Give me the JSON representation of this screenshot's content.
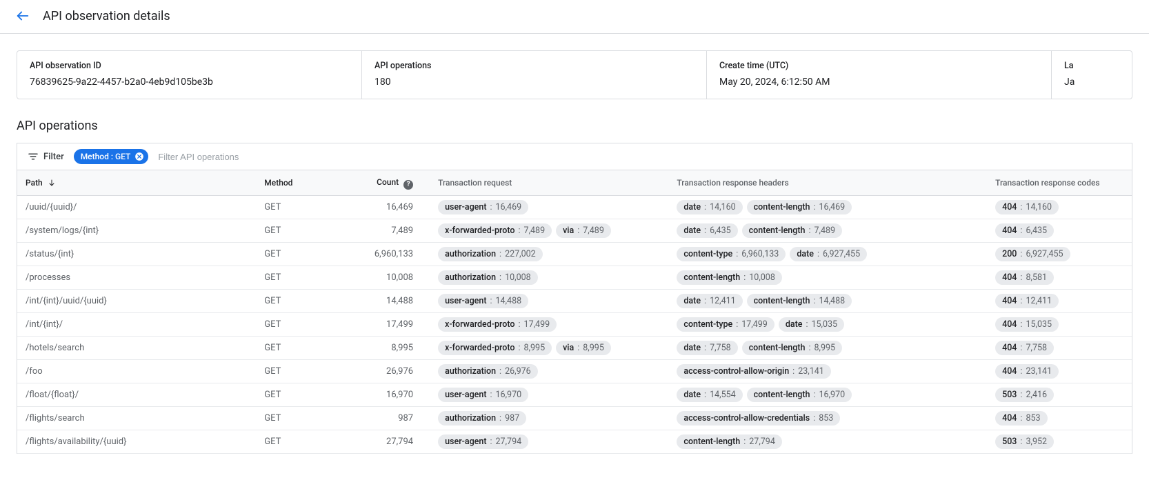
{
  "page": {
    "title": "API observation details"
  },
  "summary": {
    "id": {
      "label": "API observation ID",
      "value": "76839625-9a22-4457-b2a0-4eb9d105be3b"
    },
    "ops": {
      "label": "API operations",
      "value": "180"
    },
    "create": {
      "label": "Create time (UTC)",
      "value": "May 20, 2024, 6:12:50 AM"
    },
    "last": {
      "label": "La",
      "value": "Ja"
    }
  },
  "section": {
    "ops_title": "API operations"
  },
  "filter": {
    "label": "Filter",
    "chip": {
      "text": "Method : GET"
    },
    "placeholder": "Filter API operations"
  },
  "headers": {
    "path": "Path",
    "method": "Method",
    "count": "Count",
    "req": "Transaction request",
    "resp_h": "Transaction response headers",
    "resp_c": "Transaction response codes"
  },
  "rows": [
    {
      "path": "/uuid/{uuid}/",
      "method": "GET",
      "count": "16,469",
      "req": [
        {
          "k": "user-agent",
          "v": "16,469"
        }
      ],
      "resp_h": [
        {
          "k": "date",
          "v": "14,160"
        },
        {
          "k": "content-length",
          "v": "16,469"
        }
      ],
      "resp_c": [
        {
          "k": "404",
          "v": "14,160"
        }
      ]
    },
    {
      "path": "/system/logs/{int}",
      "method": "GET",
      "count": "7,489",
      "req": [
        {
          "k": "x-forwarded-proto",
          "v": "7,489"
        },
        {
          "k": "via",
          "v": "7,489"
        }
      ],
      "resp_h": [
        {
          "k": "date",
          "v": "6,435"
        },
        {
          "k": "content-length",
          "v": "7,489"
        }
      ],
      "resp_c": [
        {
          "k": "404",
          "v": "6,435"
        }
      ]
    },
    {
      "path": "/status/{int}",
      "method": "GET",
      "count": "6,960,133",
      "req": [
        {
          "k": "authorization",
          "v": "227,002"
        }
      ],
      "resp_h": [
        {
          "k": "content-type",
          "v": "6,960,133"
        },
        {
          "k": "date",
          "v": "6,927,455"
        }
      ],
      "resp_c": [
        {
          "k": "200",
          "v": "6,927,455"
        }
      ]
    },
    {
      "path": "/processes",
      "method": "GET",
      "count": "10,008",
      "req": [
        {
          "k": "authorization",
          "v": "10,008"
        }
      ],
      "resp_h": [
        {
          "k": "content-length",
          "v": "10,008"
        }
      ],
      "resp_c": [
        {
          "k": "404",
          "v": "8,581"
        }
      ]
    },
    {
      "path": "/int/{int}/uuid/{uuid}",
      "method": "GET",
      "count": "14,488",
      "req": [
        {
          "k": "user-agent",
          "v": "14,488"
        }
      ],
      "resp_h": [
        {
          "k": "date",
          "v": "12,411"
        },
        {
          "k": "content-length",
          "v": "14,488"
        }
      ],
      "resp_c": [
        {
          "k": "404",
          "v": "12,411"
        }
      ]
    },
    {
      "path": "/int/{int}/",
      "method": "GET",
      "count": "17,499",
      "req": [
        {
          "k": "x-forwarded-proto",
          "v": "17,499"
        }
      ],
      "resp_h": [
        {
          "k": "content-type",
          "v": "17,499"
        },
        {
          "k": "date",
          "v": "15,035"
        }
      ],
      "resp_c": [
        {
          "k": "404",
          "v": "15,035"
        }
      ]
    },
    {
      "path": "/hotels/search",
      "method": "GET",
      "count": "8,995",
      "req": [
        {
          "k": "x-forwarded-proto",
          "v": "8,995"
        },
        {
          "k": "via",
          "v": "8,995"
        }
      ],
      "resp_h": [
        {
          "k": "date",
          "v": "7,758"
        },
        {
          "k": "content-length",
          "v": "8,995"
        }
      ],
      "resp_c": [
        {
          "k": "404",
          "v": "7,758"
        }
      ]
    },
    {
      "path": "/foo",
      "method": "GET",
      "count": "26,976",
      "req": [
        {
          "k": "authorization",
          "v": "26,976"
        }
      ],
      "resp_h": [
        {
          "k": "access-control-allow-origin",
          "v": "23,141"
        }
      ],
      "resp_c": [
        {
          "k": "404",
          "v": "23,141"
        }
      ]
    },
    {
      "path": "/float/{float}/",
      "method": "GET",
      "count": "16,970",
      "req": [
        {
          "k": "user-agent",
          "v": "16,970"
        }
      ],
      "resp_h": [
        {
          "k": "date",
          "v": "14,554"
        },
        {
          "k": "content-length",
          "v": "16,970"
        }
      ],
      "resp_c": [
        {
          "k": "503",
          "v": "2,416"
        }
      ]
    },
    {
      "path": "/flights/search",
      "method": "GET",
      "count": "987",
      "req": [
        {
          "k": "authorization",
          "v": "987"
        }
      ],
      "resp_h": [
        {
          "k": "access-control-allow-credentials",
          "v": "853"
        }
      ],
      "resp_c": [
        {
          "k": "404",
          "v": "853"
        }
      ]
    },
    {
      "path": "/flights/availability/{uuid}",
      "method": "GET",
      "count": "27,794",
      "req": [
        {
          "k": "user-agent",
          "v": "27,794"
        }
      ],
      "resp_h": [
        {
          "k": "content-length",
          "v": "27,794"
        }
      ],
      "resp_c": [
        {
          "k": "503",
          "v": "3,952"
        }
      ]
    }
  ]
}
